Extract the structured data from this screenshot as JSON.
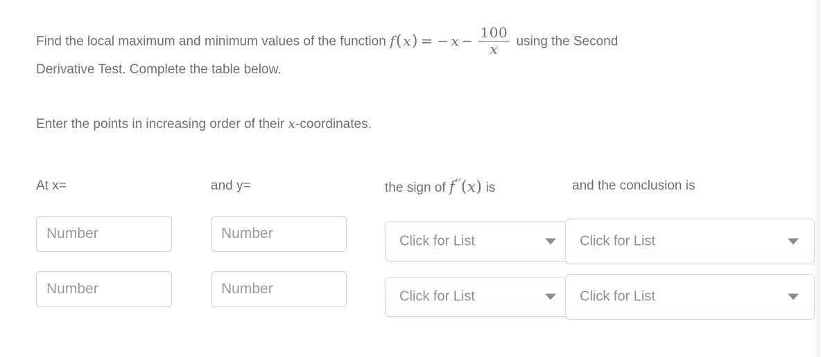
{
  "question": {
    "line1_part1": "Find the local maximum and minimum values of the function ",
    "formula": {
      "fn": "f",
      "open_paren": "(",
      "variable": "x",
      "close_paren": ")",
      "equals": "=",
      "minus1": "−",
      "term_x": "x",
      "minus2": "−",
      "frac_numerator": "100",
      "frac_denominator": "x"
    },
    "line1_part2": " using the Second",
    "line2": "Derivative Test. Complete the table below.",
    "instruction_part1": "Enter the points in increasing order of their ",
    "instruction_var": "x",
    "instruction_part2": "-coordinates."
  },
  "headers": {
    "at_x": "At x=",
    "and_y": "and y=",
    "sign_prefix": "the sign of ",
    "sign_fn": "f",
    "sign_primes": "′′",
    "sign_open_paren": "(",
    "sign_var": "x",
    "sign_close_paren": ")",
    "sign_suffix": " is",
    "conclusion": "and the conclusion is"
  },
  "rows": [
    {
      "x_placeholder": "Number",
      "y_placeholder": "Number",
      "sign_label": "Click for List",
      "conclusion_label": "Click for List"
    },
    {
      "x_placeholder": "Number",
      "y_placeholder": "Number",
      "sign_label": "Click for List",
      "conclusion_label": "Click for List"
    }
  ],
  "colors": {
    "text": "#6f6f6f",
    "placeholder": "#9a9a9a",
    "border": "#d2d2d2",
    "background": "#ffffff"
  }
}
